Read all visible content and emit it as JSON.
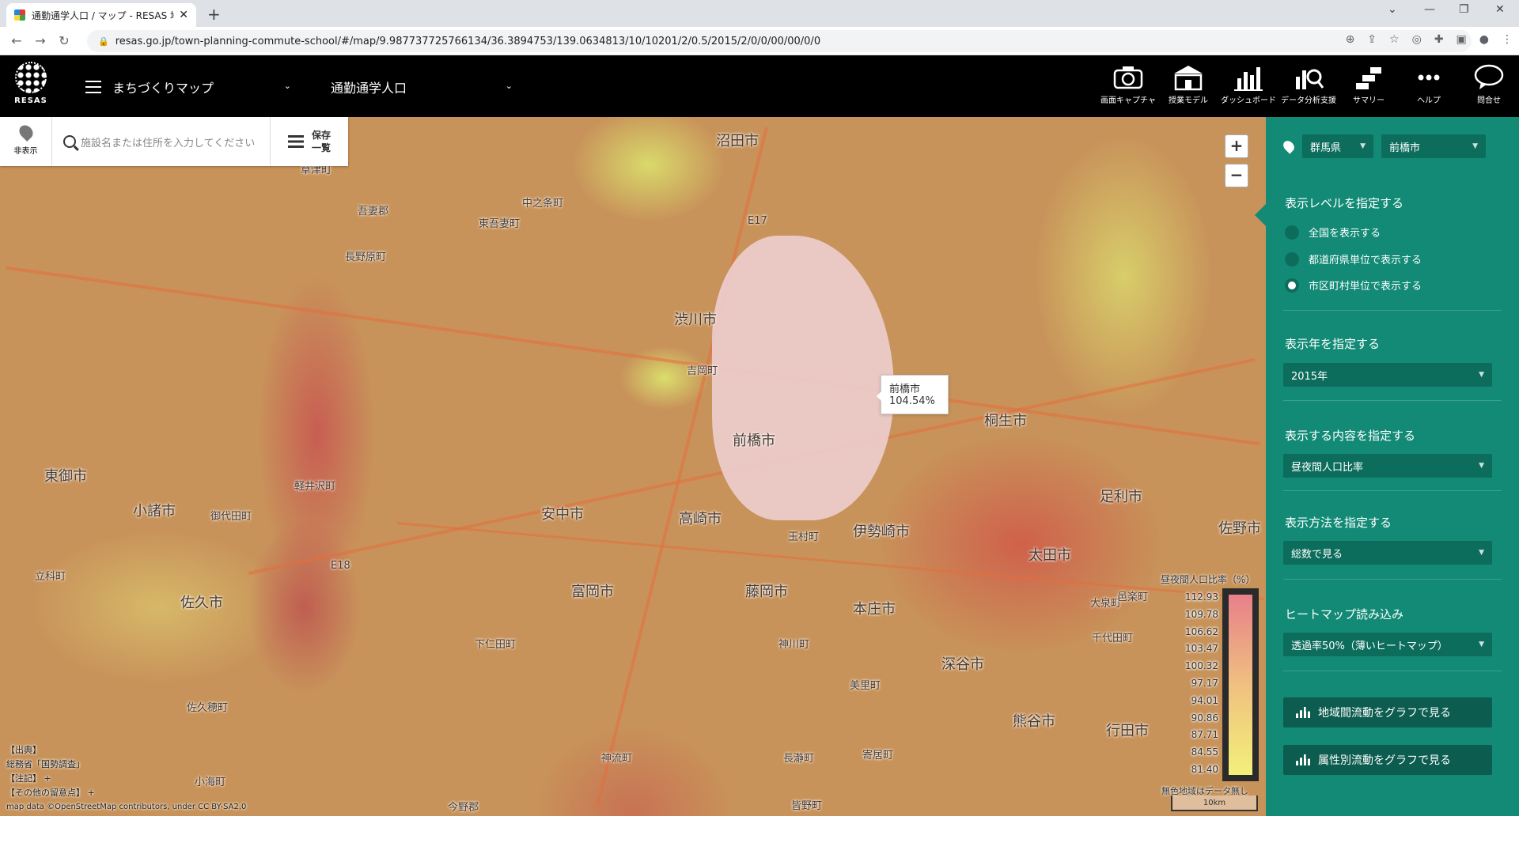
{
  "browser": {
    "tab_title": "通勤通学人口 / マップ - RESAS 地域",
    "url": "resas.go.jp/town-planning-commute-school/#/map/9.987737725766134/36.3894753/139.0634813/10/10201/2/0.5/2015/2/0/0/00/00/0/0"
  },
  "app": {
    "logo_text": "RESAS",
    "map_menu": "まちづくりマップ",
    "theme": "通勤通学人口",
    "tools": [
      {
        "label": "画面キャプチャ",
        "icon": "camera-icon"
      },
      {
        "label": "授業モデル",
        "icon": "school-icon"
      },
      {
        "label": "ダッシュボード",
        "icon": "dashboard-icon"
      },
      {
        "label": "データ分析支援",
        "icon": "analysis-icon"
      },
      {
        "label": "サマリー",
        "icon": "summary-icon"
      },
      {
        "label": "ヘルプ",
        "icon": "more-icon"
      },
      {
        "label": "問合せ",
        "icon": "chat-icon"
      }
    ]
  },
  "map": {
    "hide_label": "非表示",
    "search_placeholder": "施設名または住所を入力してください",
    "save_list_label": "保存\n一覧",
    "zoom_in": "+",
    "zoom_out": "−",
    "tooltip": {
      "name": "前橋市",
      "value": "104.54%"
    },
    "legend": {
      "title": "昼夜間人口比率（%）",
      "values": [
        "112.93",
        "109.78",
        "106.62",
        "103.47",
        "100.32",
        "97.17",
        "94.01",
        "90.86",
        "87.71",
        "84.55",
        "81.40"
      ],
      "note": "無色地域はデータ無し",
      "scale": "10km"
    },
    "source": {
      "line1": "【出典】",
      "line2": "総務省「国勢調査」",
      "line3": "【注記】 +",
      "line4": "【その他の留意点】 +",
      "copyright": "map data ©OpenStreetMap contributors, under CC BY-SA2.0"
    },
    "places": [
      {
        "name": "沼田市"
      },
      {
        "name": "中之条町"
      },
      {
        "name": "東吾妻町"
      },
      {
        "name": "長野原町"
      },
      {
        "name": "吾妻郡"
      },
      {
        "name": "渋川市"
      },
      {
        "name": "吉岡町"
      },
      {
        "name": "前橋市"
      },
      {
        "name": "桐生市"
      },
      {
        "name": "東御市"
      },
      {
        "name": "小諸市"
      },
      {
        "name": "御代田町"
      },
      {
        "name": "軽井沢町"
      },
      {
        "name": "安中市"
      },
      {
        "name": "高崎市"
      },
      {
        "name": "玉村町"
      },
      {
        "name": "伊勢崎市"
      },
      {
        "name": "太田市"
      },
      {
        "name": "足利市"
      },
      {
        "name": "佐野市"
      },
      {
        "name": "富岡市"
      },
      {
        "name": "藤岡市"
      },
      {
        "name": "本庄市"
      },
      {
        "name": "佐久市"
      },
      {
        "name": "下仁田町"
      },
      {
        "name": "深谷市"
      },
      {
        "name": "千代田町"
      },
      {
        "name": "大泉町"
      },
      {
        "name": "邑楽町"
      },
      {
        "name": "神川町"
      },
      {
        "name": "美里町"
      },
      {
        "name": "熊谷市"
      },
      {
        "name": "行田市"
      },
      {
        "name": "神流町"
      },
      {
        "name": "長瀞町"
      },
      {
        "name": "寄居町"
      },
      {
        "name": "佐久穂町"
      },
      {
        "name": "小海町"
      },
      {
        "name": "立科町"
      },
      {
        "name": "今野郡"
      },
      {
        "name": "皆野町"
      },
      {
        "name": "E17"
      },
      {
        "name": "E18"
      },
      {
        "name": "草津町"
      }
    ]
  },
  "panel": {
    "prefecture": "群馬県",
    "city": "前橋市",
    "level_title": "表示レベルを指定する",
    "levels": [
      {
        "label": "全国を表示する",
        "selected": false
      },
      {
        "label": "都道府県単位で表示する",
        "selected": false
      },
      {
        "label": "市区町村単位で表示する",
        "selected": true
      }
    ],
    "year_title": "表示年を指定する",
    "year": "2015年",
    "content_title": "表示する内容を指定する",
    "content": "昼夜間人口比率",
    "method_title": "表示方法を指定する",
    "method": "総数で見る",
    "heatmap_title": "ヒートマップ読み込み",
    "heatmap": "透過率50%（薄いヒートマップ）",
    "graph_btn1": "地域間流動をグラフで見る",
    "graph_btn2": "属性別流動をグラフで見る"
  },
  "colors": {
    "panel": "#128a76",
    "panel_dark": "#0c6d5d",
    "header": "#000000"
  }
}
